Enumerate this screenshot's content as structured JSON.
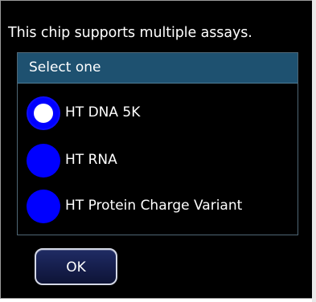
{
  "dialog": {
    "message": "This chip supports multiple assays.",
    "panel_title": "Select one",
    "selected_index": 0,
    "options": [
      {
        "label": "HT DNA 5K",
        "selected": true
      },
      {
        "label": "HT RNA",
        "selected": false
      },
      {
        "label": "HT Protein Charge Variant",
        "selected": false
      }
    ],
    "ok_label": "OK"
  },
  "colors": {
    "background": "#000000",
    "panel_header": "#1e5170",
    "radio": "#0000ff",
    "radio_selected_dot": "#ffffff",
    "button": "#172050",
    "text": "#ffffff"
  }
}
